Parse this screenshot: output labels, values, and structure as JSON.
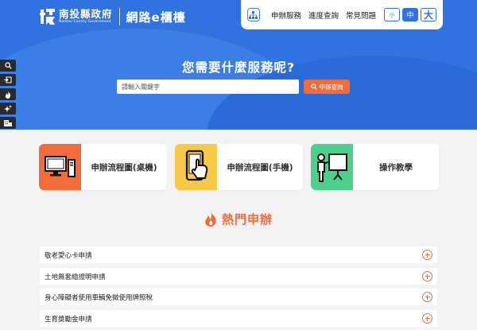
{
  "header": {
    "logo_cn": "南投縣政府",
    "logo_en": "Nantou County Government",
    "site_name": "網路e櫃檯",
    "nav": [
      "申辦服務",
      "進度查詢",
      "常見問題"
    ],
    "font_sizes": [
      "小",
      "中",
      "大"
    ]
  },
  "side_tools": [
    "search-icon",
    "login-icon",
    "fire-icon",
    "sparkle-icon",
    "building-icon"
  ],
  "hero": {
    "title": "您需要什麼服務呢?",
    "search_placeholder": "請輸入關鍵字",
    "search_button": "申辦查詢"
  },
  "cards": [
    {
      "label": "申辦流程圖(桌機)",
      "icon": "desktop-computer-icon",
      "color": "#f26b3a"
    },
    {
      "label": "申辦流程圖(手機)",
      "icon": "mobile-phone-icon",
      "color": "#f7c948"
    },
    {
      "label": "操作教學",
      "icon": "teaching-icon",
      "color": "#4ccf8a"
    }
  ],
  "hot": {
    "title": "熱門申辦",
    "items": [
      "敬老愛心卡申請",
      "土地無套繪證明申請",
      "身心障礙者使用車輛免徵使用牌照稅",
      "生育獎勵金申請"
    ]
  },
  "colors": {
    "primary": "#2f72e0",
    "accent": "#f26b3a"
  }
}
